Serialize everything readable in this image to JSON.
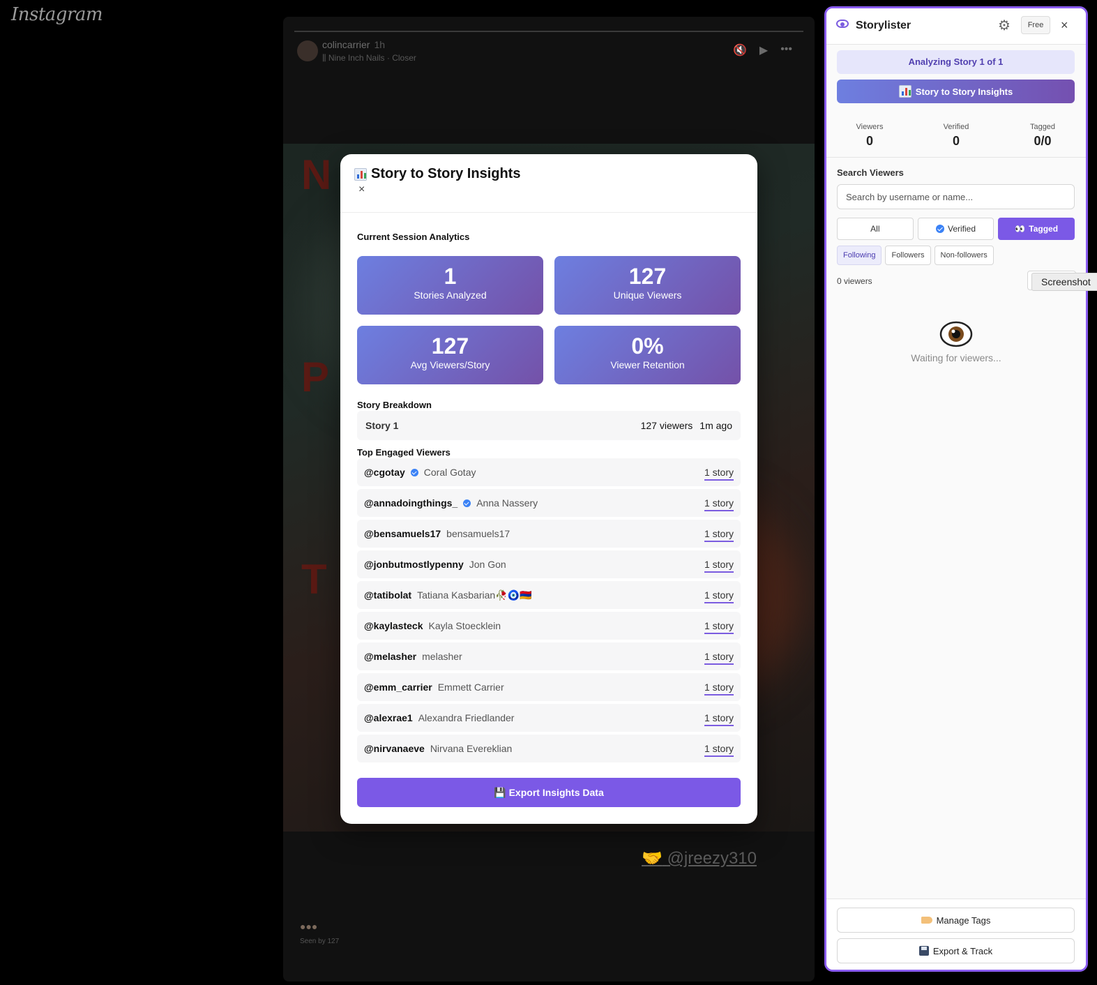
{
  "background": {
    "ig_logo": "Instagram",
    "story": {
      "username": "colincarrier",
      "age": "1h",
      "track": "Nine Inch Nails · Closer",
      "tag": "@jreezy310",
      "seen_by": "Seen by 127"
    }
  },
  "modal": {
    "title": "Story to Story Insights",
    "close": "×",
    "session_label": "Current Session Analytics",
    "stats": [
      {
        "value": "1",
        "label": "Stories Analyzed"
      },
      {
        "value": "127",
        "label": "Unique Viewers"
      },
      {
        "value": "127",
        "label": "Avg Viewers/Story"
      },
      {
        "value": "0%",
        "label": "Viewer Retention"
      }
    ],
    "breakdown_label": "Story Breakdown",
    "breakdown": {
      "story": "Story 1",
      "viewers": "127 viewers",
      "ago": "1m ago"
    },
    "top_viewers_label": "Top Engaged Viewers",
    "viewers": [
      {
        "handle": "@cgotay",
        "name": "Coral Gotay",
        "verified": true,
        "count": "1 story"
      },
      {
        "handle": "@annadoingthings_",
        "name": "Anna Nassery",
        "verified": true,
        "count": "1 story"
      },
      {
        "handle": "@bensamuels17",
        "name": "bensamuels17",
        "verified": false,
        "count": "1 story"
      },
      {
        "handle": "@jonbutmostlypenny",
        "name": "Jon Gon",
        "verified": false,
        "count": "1 story"
      },
      {
        "handle": "@tatibolat",
        "name": "Tatiana Kasbarian🥀🧿🇦🇲",
        "verified": false,
        "count": "1 story"
      },
      {
        "handle": "@kaylasteck",
        "name": "Kayla Stoecklein",
        "verified": false,
        "count": "1 story"
      },
      {
        "handle": "@melasher",
        "name": "melasher",
        "verified": false,
        "count": "1 story"
      },
      {
        "handle": "@emm_carrier",
        "name": "Emmett Carrier",
        "verified": false,
        "count": "1 story"
      },
      {
        "handle": "@alexrae1",
        "name": "Alexandra Friedlander",
        "verified": false,
        "count": "1 story"
      },
      {
        "handle": "@nirvanaeve",
        "name": "Nirvana Evereklian",
        "verified": false,
        "count": "1 story"
      }
    ],
    "export_button": "Export Insights Data"
  },
  "panel": {
    "title": "Storylister",
    "plan": "Free",
    "close": "×",
    "analyzing": "Analyzing Story 1 of 1",
    "insights_button": "Story to Story Insights",
    "stats": [
      {
        "label": "Viewers",
        "value": "0"
      },
      {
        "label": "Verified",
        "value": "0"
      },
      {
        "label": "Tagged",
        "value": "0/0"
      }
    ],
    "search_label": "Search Viewers",
    "search_placeholder": "Search by username or name...",
    "filters": {
      "all": "All",
      "verified": "Verified",
      "tagged": "Tagged"
    },
    "relations": {
      "following": "Following",
      "followers": "Followers",
      "non_followers": "Non-followers"
    },
    "viewer_count": "0 viewers",
    "tooltip": "Screenshot",
    "waiting": "Waiting for viewers...",
    "manage_tags": "Manage Tags",
    "export_track": "Export & Track"
  },
  "colors": {
    "accent": "#7b59e6",
    "panel_border": "#8a5cf0",
    "verified": "#3b82f6"
  }
}
